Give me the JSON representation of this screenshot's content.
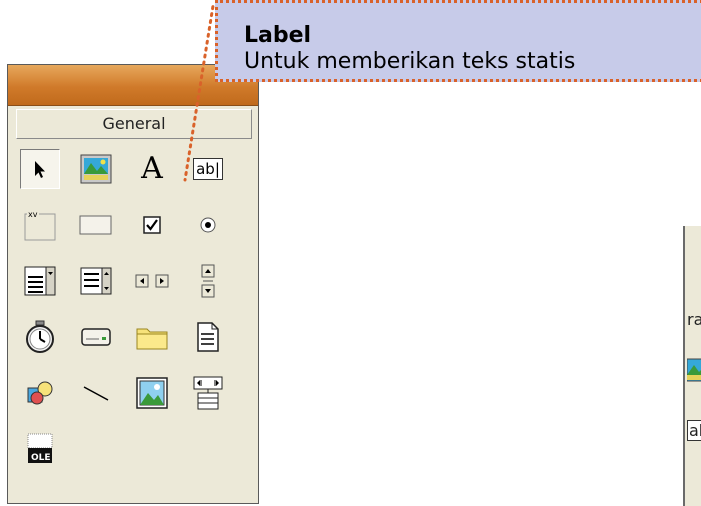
{
  "toolbox": {
    "tab_label": "General",
    "tools": [
      {
        "name": "pointer",
        "icon": "pointer-icon",
        "selected": true
      },
      {
        "name": "picturebox",
        "icon": "picturebox-icon"
      },
      {
        "name": "label",
        "icon": "label-icon",
        "glyph": "A"
      },
      {
        "name": "textbox",
        "icon": "textbox-icon",
        "glyph": "ab|"
      },
      {
        "name": "frame",
        "icon": "frame-icon",
        "glyph": "xv"
      },
      {
        "name": "commandbutton",
        "icon": "commandbutton-icon"
      },
      {
        "name": "checkbox",
        "icon": "checkbox-icon"
      },
      {
        "name": "optionbutton",
        "icon": "optionbutton-icon"
      },
      {
        "name": "combobox",
        "icon": "combobox-icon"
      },
      {
        "name": "listbox",
        "icon": "listbox-icon"
      },
      {
        "name": "hscrollbar",
        "icon": "hscrollbar-icon"
      },
      {
        "name": "vscrollbar",
        "icon": "vscrollbar-icon"
      },
      {
        "name": "timer",
        "icon": "timer-icon"
      },
      {
        "name": "drivelistbox",
        "icon": "drivelistbox-icon"
      },
      {
        "name": "dirlistbox",
        "icon": "dirlistbox-icon"
      },
      {
        "name": "filelistbox",
        "icon": "filelistbox-icon"
      },
      {
        "name": "shape",
        "icon": "shape-icon"
      },
      {
        "name": "line",
        "icon": "line-icon"
      },
      {
        "name": "image",
        "icon": "image-icon"
      },
      {
        "name": "data",
        "icon": "data-icon"
      },
      {
        "name": "ole",
        "icon": "ole-icon",
        "glyph": "OLE"
      }
    ]
  },
  "callout": {
    "title": "Label",
    "description": "Untuk memberikan teks statis"
  },
  "partial_toolbox": {
    "fragment_top": "ra",
    "fragment_bottom": "ab"
  },
  "colors": {
    "titlebar": "#d07a2a",
    "callout_bg": "#c7cbe9",
    "callout_border": "#d9622a"
  }
}
